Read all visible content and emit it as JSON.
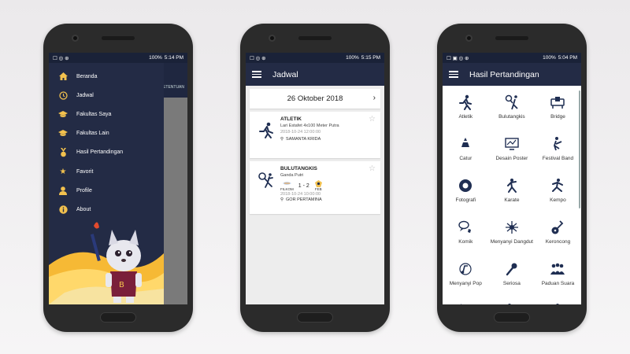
{
  "status1": {
    "icons_left": "☐ ◎ ⊕",
    "battery": "100%",
    "time": "5:14 PM"
  },
  "status2": {
    "icons_left": "☐ ◎ ⊕",
    "battery": "100%",
    "time": "5:15 PM"
  },
  "status3": {
    "icons_left": "☐ ▣ ◎ ⊕",
    "battery": "100%",
    "time": "5:04 PM"
  },
  "drawer": {
    "background_tab": "KETENTUAN",
    "items": [
      {
        "label": "Beranda",
        "icon": "home-icon"
      },
      {
        "label": "Jadwal",
        "icon": "clock-icon"
      },
      {
        "label": "Fakultas Saya",
        "icon": "graduation-cap-icon"
      },
      {
        "label": "Fakultas Lain",
        "icon": "graduation-cap-icon"
      },
      {
        "label": "Hasil Pertandingan",
        "icon": "medal-icon"
      },
      {
        "label": "Favorit",
        "icon": "star-icon"
      },
      {
        "label": "Profile",
        "icon": "person-icon"
      },
      {
        "label": "About",
        "icon": "info-icon"
      }
    ],
    "accent": "#f2c14e"
  },
  "schedule": {
    "title": "Jadwal",
    "date": "26 Oktober 2018",
    "events": [
      {
        "sport": "ATLETIK",
        "event": "Lari Estafet 4x100 Meter Putra",
        "datetime": "2018-10-24 12:00:00",
        "venue": "SAMANTA KRIDA"
      },
      {
        "sport": "BULUTANGKIS",
        "event": "Ganda Putri",
        "team_a": "FILKOM",
        "score": "1 - 2",
        "team_b": "FEB",
        "datetime": "2018-10-24 10:00:00",
        "venue": "GOR PERTAMINA"
      }
    ]
  },
  "results": {
    "title": "Hasil Pertandingan",
    "categories": [
      {
        "label": "Atletik",
        "icon": "runner-icon"
      },
      {
        "label": "Bulutangkis",
        "icon": "badminton-icon"
      },
      {
        "label": "Bridge",
        "icon": "bridge-icon"
      },
      {
        "label": "Catur",
        "icon": "chess-icon"
      },
      {
        "label": "Desain Poster",
        "icon": "poster-icon"
      },
      {
        "label": "Festival Band",
        "icon": "band-icon"
      },
      {
        "label": "Fotografi",
        "icon": "camera-icon"
      },
      {
        "label": "Karate",
        "icon": "karate-icon"
      },
      {
        "label": "Kempo",
        "icon": "kempo-icon"
      },
      {
        "label": "Komik",
        "icon": "comic-icon"
      },
      {
        "label": "Menyanyi Dangdut",
        "icon": "dangdut-icon"
      },
      {
        "label": "Keroncong",
        "icon": "guitar-icon"
      },
      {
        "label": "Menyanyi Pop",
        "icon": "pop-icon"
      },
      {
        "label": "Seriosa",
        "icon": "microphone-icon"
      },
      {
        "label": "Paduan Suara",
        "icon": "choir-icon"
      },
      {
        "label": "",
        "icon": "archery-icon"
      },
      {
        "label": "",
        "icon": "kick-icon"
      },
      {
        "label": "",
        "icon": "runner2-icon"
      }
    ]
  },
  "colors": {
    "navy": "#232b45",
    "status": "#1a2238",
    "icon_blue": "#1f2e52"
  }
}
